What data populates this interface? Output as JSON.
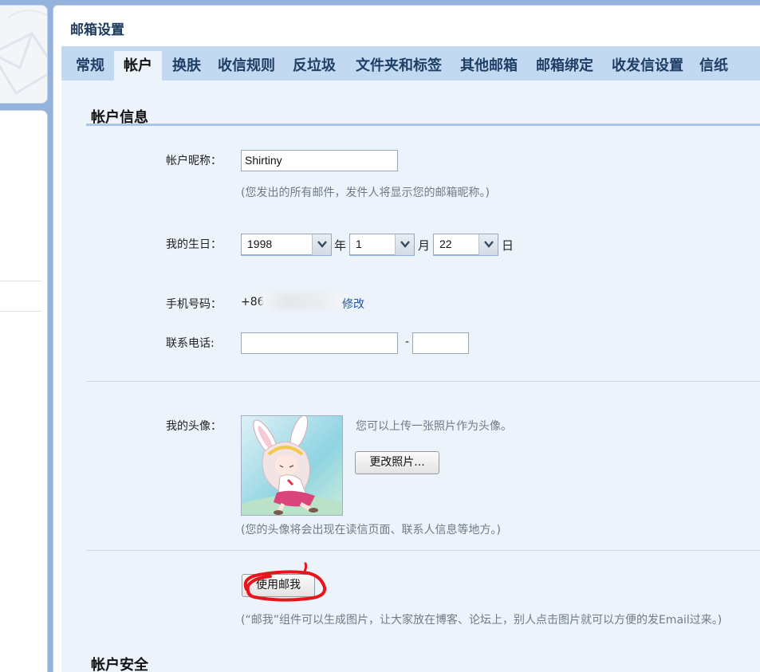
{
  "settings": {
    "title": "邮箱设置",
    "tabs": [
      {
        "label": "常规"
      },
      {
        "label": "帐户"
      },
      {
        "label": "换肤"
      },
      {
        "label": "收信规则"
      },
      {
        "label": "反垃圾"
      },
      {
        "label": "文件夹和标签"
      },
      {
        "label": "其他邮箱"
      },
      {
        "label": "邮箱绑定"
      },
      {
        "label": "收发信设置"
      },
      {
        "label": "信纸"
      }
    ],
    "active_tab": "帐户"
  },
  "account_info": {
    "section_title": "帐户信息",
    "nickname": {
      "label": "帐户昵称：",
      "value": "Shirtiny",
      "hint": "(您发出的所有邮件，发件人将显示您的邮箱昵称。)"
    },
    "birthday": {
      "label": "我的生日：",
      "year": "1998",
      "year_unit": "年",
      "month": "1",
      "month_unit": "月",
      "day": "22",
      "day_unit": "日"
    },
    "mobile": {
      "label": "手机号码：",
      "prefix": "+86",
      "modify_link": "修改"
    },
    "phone": {
      "label": "联系电话:",
      "separator": "-",
      "area_value": "",
      "number_value": ""
    },
    "avatar": {
      "label": "我的头像：",
      "side_hint": "您可以上传一张照片作为头像。",
      "change_button": "更改照片...",
      "hint": "(您的头像将会出现在读信页面、联系人信息等地方。)"
    },
    "mail_me": {
      "button": "使用邮我",
      "hint": "(“邮我”组件可以生成图片，让大家放在博客、论坛上，别人点击图片就可以方便的发Email过来。)",
      "annotation_color": "#e8141c"
    }
  },
  "account_security": {
    "section_title": "帐户安全"
  }
}
